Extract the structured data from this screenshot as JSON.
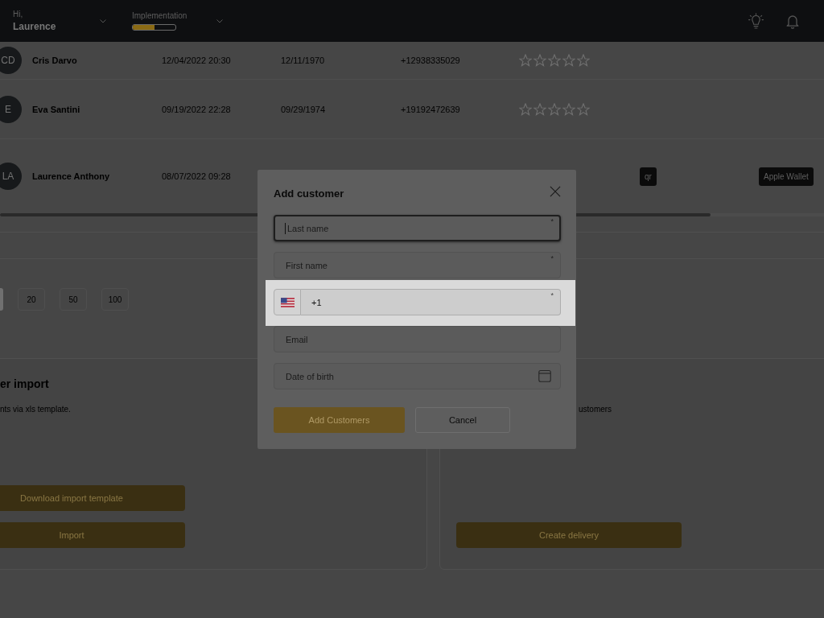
{
  "header": {
    "greeting": "Hi,",
    "user": "Laurence",
    "implementation": {
      "label": "Implementation",
      "level": 0.5
    }
  },
  "table": {
    "rows": [
      {
        "initials": "CD",
        "name": "Cris Darvo",
        "created": "12/04/2022 20:30",
        "birth_date": "12/11/1970",
        "phone": "+12938335029",
        "stars": 0
      },
      {
        "initials": "E",
        "name": "Eva Santini",
        "created": "09/19/2022 22:28",
        "birth_date": "09/29/1974",
        "phone": "+19192472639",
        "stars": 0
      },
      {
        "initials": "LA",
        "name": "Laurence Anthony",
        "created": "08/07/2022 09:28",
        "qr": "qr",
        "wallet": "Apple Wallet"
      }
    ]
  },
  "pagination": {
    "options": [
      {
        "selected": true
      },
      {
        "label": "20",
        "selected": false
      },
      {
        "label": "50",
        "selected": false
      },
      {
        "label": "100",
        "selected": false
      }
    ]
  },
  "cards": [
    {
      "title": "er import",
      "description": "nts via xls template.",
      "buttons": [
        "Download import template",
        "Import"
      ]
    },
    {
      "description": "ustomers",
      "buttons": [
        "Create delivery"
      ]
    }
  ],
  "modal": {
    "title": "Add customer",
    "fields": [
      {
        "kind": "text",
        "placeholder": "Last name",
        "required_mark": "*",
        "focused": true,
        "highlighted": false
      },
      {
        "kind": "text",
        "placeholder": "First name",
        "required_mark": "*",
        "focused": false,
        "highlighted": false
      },
      {
        "kind": "phone",
        "value": "+1",
        "required_mark": "*",
        "focused": false,
        "highlighted": true
      },
      {
        "kind": "text",
        "placeholder": "Email",
        "focused": false,
        "highlighted": false
      },
      {
        "kind": "date",
        "placeholder": "Date of birth",
        "focused": false,
        "highlighted": false
      }
    ],
    "buttons": [
      {
        "kind": "primary",
        "label": "Add Customers"
      },
      {
        "kind": "secondary",
        "label": "Cancel"
      }
    ]
  }
}
